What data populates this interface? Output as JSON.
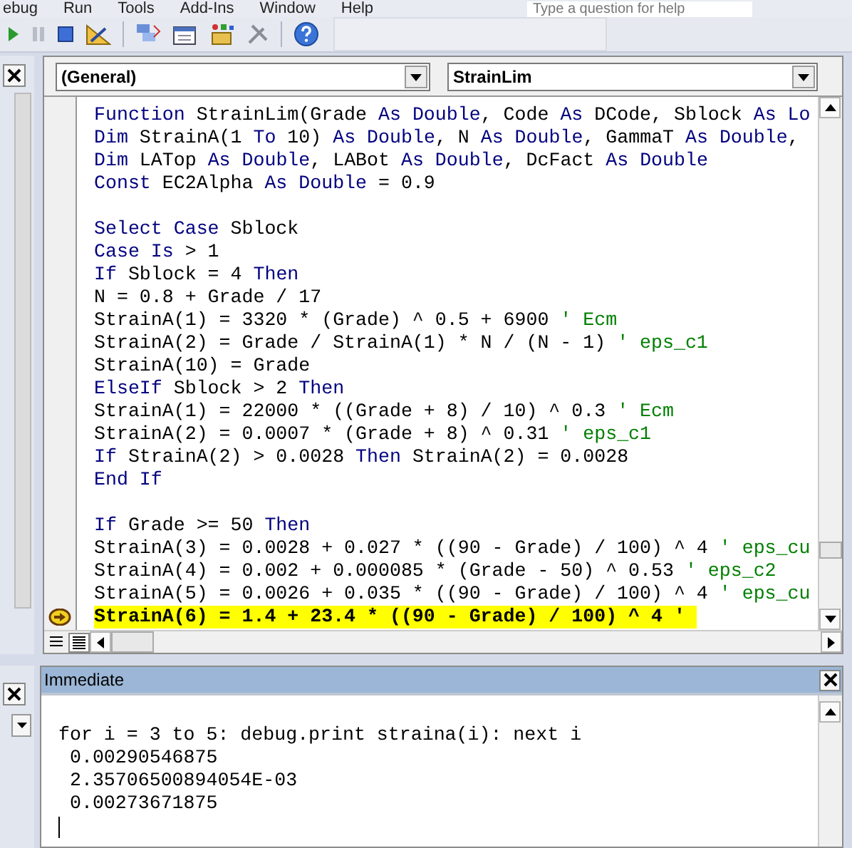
{
  "menu": [
    {
      "label": "ebug"
    },
    {
      "label": "Run"
    },
    {
      "label": "Tools"
    },
    {
      "label": "Add-Ins"
    },
    {
      "label": "Window"
    },
    {
      "label": "Help"
    }
  ],
  "help_search": {
    "placeholder": "Type a question for help"
  },
  "code_window": {
    "object_box": "(General)",
    "procedure_box": "StrainLim",
    "lines": [
      {
        "executing": false,
        "segments": [
          {
            "kind": "keyword",
            "text": "Function"
          },
          {
            "kind": "plain",
            "text": " StrainLim(Grade "
          },
          {
            "kind": "keyword",
            "text": "As Double"
          },
          {
            "kind": "plain",
            "text": ", Code "
          },
          {
            "kind": "keyword",
            "text": "As"
          },
          {
            "kind": "plain",
            "text": " DCode, Sblock "
          },
          {
            "kind": "keyword",
            "text": "As Lo"
          }
        ]
      },
      {
        "executing": false,
        "segments": [
          {
            "kind": "keyword",
            "text": "Dim"
          },
          {
            "kind": "plain",
            "text": " StrainA(1 "
          },
          {
            "kind": "keyword",
            "text": "To"
          },
          {
            "kind": "plain",
            "text": " 10) "
          },
          {
            "kind": "keyword",
            "text": "As Double"
          },
          {
            "kind": "plain",
            "text": ", N "
          },
          {
            "kind": "keyword",
            "text": "As Double"
          },
          {
            "kind": "plain",
            "text": ", GammaT "
          },
          {
            "kind": "keyword",
            "text": "As Double"
          },
          {
            "kind": "plain",
            "text": ","
          }
        ]
      },
      {
        "executing": false,
        "segments": [
          {
            "kind": "keyword",
            "text": "Dim"
          },
          {
            "kind": "plain",
            "text": " LATop "
          },
          {
            "kind": "keyword",
            "text": "As Double"
          },
          {
            "kind": "plain",
            "text": ", LABot "
          },
          {
            "kind": "keyword",
            "text": "As Double"
          },
          {
            "kind": "plain",
            "text": ", DcFact "
          },
          {
            "kind": "keyword",
            "text": "As Double"
          }
        ]
      },
      {
        "executing": false,
        "segments": [
          {
            "kind": "keyword",
            "text": "Const"
          },
          {
            "kind": "plain",
            "text": " EC2Alpha "
          },
          {
            "kind": "keyword",
            "text": "As Double"
          },
          {
            "kind": "plain",
            "text": " = 0.9"
          }
        ]
      },
      {
        "executing": false
      },
      {
        "executing": false,
        "segments": [
          {
            "kind": "keyword",
            "text": "Select Case"
          },
          {
            "kind": "plain",
            "text": " Sblock"
          }
        ]
      },
      {
        "executing": false,
        "segments": [
          {
            "kind": "keyword",
            "text": "Case Is"
          },
          {
            "kind": "plain",
            "text": " > 1"
          }
        ]
      },
      {
        "executing": false,
        "segments": [
          {
            "kind": "keyword",
            "text": "If"
          },
          {
            "kind": "plain",
            "text": " Sblock = 4 "
          },
          {
            "kind": "keyword",
            "text": "Then"
          }
        ]
      },
      {
        "executing": false,
        "segments": [
          {
            "kind": "plain",
            "text": "N = 0.8 + Grade / 17"
          }
        ]
      },
      {
        "executing": false,
        "segments": [
          {
            "kind": "plain",
            "text": "StrainA(1) = 3320 * (Grade) ^ 0.5 + 6900 "
          },
          {
            "kind": "comment",
            "text": "' Ecm"
          }
        ]
      },
      {
        "executing": false,
        "segments": [
          {
            "kind": "plain",
            "text": "StrainA(2) = Grade / StrainA(1) * N / (N - 1) "
          },
          {
            "kind": "comment",
            "text": "' eps_c1"
          }
        ]
      },
      {
        "executing": false,
        "segments": [
          {
            "kind": "plain",
            "text": "StrainA(10) = Grade"
          }
        ]
      },
      {
        "executing": false,
        "segments": [
          {
            "kind": "keyword",
            "text": "ElseIf"
          },
          {
            "kind": "plain",
            "text": " Sblock > 2 "
          },
          {
            "kind": "keyword",
            "text": "Then"
          }
        ]
      },
      {
        "executing": false,
        "segments": [
          {
            "kind": "plain",
            "text": "StrainA(1) = 22000 * ((Grade + 8) / 10) ^ 0.3 "
          },
          {
            "kind": "comment",
            "text": "' Ecm"
          }
        ]
      },
      {
        "executing": false,
        "segments": [
          {
            "kind": "plain",
            "text": "StrainA(2) = 0.0007 * (Grade + 8) ^ 0.31 "
          },
          {
            "kind": "comment",
            "text": "' eps_c1"
          }
        ]
      },
      {
        "executing": false,
        "segments": [
          {
            "kind": "keyword",
            "text": "If"
          },
          {
            "kind": "plain",
            "text": " StrainA(2) > 0.0028 "
          },
          {
            "kind": "keyword",
            "text": "Then"
          },
          {
            "kind": "plain",
            "text": " StrainA(2) = 0.0028"
          }
        ]
      },
      {
        "executing": false,
        "segments": [
          {
            "kind": "keyword",
            "text": "End If"
          }
        ]
      },
      {
        "executing": false
      },
      {
        "executing": false,
        "segments": [
          {
            "kind": "keyword",
            "text": "If"
          },
          {
            "kind": "plain",
            "text": " Grade >= 50 "
          },
          {
            "kind": "keyword",
            "text": "Then"
          }
        ]
      },
      {
        "executing": false,
        "segments": [
          {
            "kind": "plain",
            "text": "StrainA(3) = 0.0028 + 0.027 * ((90 - Grade) / 100) ^ 4 "
          },
          {
            "kind": "comment",
            "text": "' eps_cu"
          }
        ]
      },
      {
        "executing": false,
        "segments": [
          {
            "kind": "plain",
            "text": "StrainA(4) = 0.002 + 0.000085 * (Grade - 50) ^ 0.53 "
          },
          {
            "kind": "comment",
            "text": "' eps_c2"
          }
        ]
      },
      {
        "executing": false,
        "segments": [
          {
            "kind": "plain",
            "text": "StrainA(5) = 0.0026 + 0.035 * ((90 - Grade) / 100) ^ 4 "
          },
          {
            "kind": "comment",
            "text": "' eps_cu"
          }
        ]
      },
      {
        "executing": true,
        "segments": [
          {
            "kind": "plain",
            "text": "StrainA(6) = 1.4 + 23.4 * ((90 - Grade) / 100) ^ 4 ' "
          }
        ]
      }
    ]
  },
  "immediate": {
    "title": "Immediate",
    "lines": [
      "for i = 3 to 5: debug.print straina(i): next i",
      " 0.00290546875",
      " 2.35706500894054E-03",
      " 0.00273671875"
    ]
  }
}
